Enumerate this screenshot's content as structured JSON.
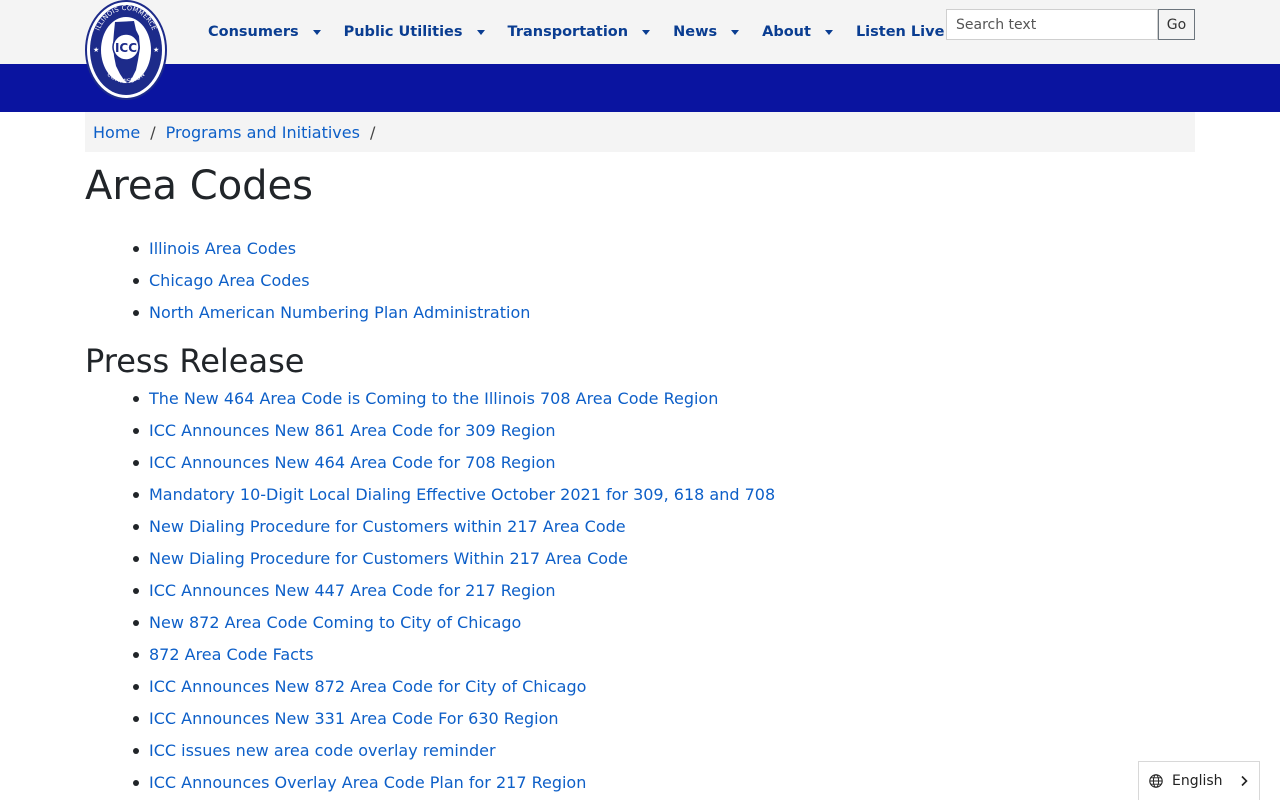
{
  "header": {
    "logo": {
      "alt_text": "ICC",
      "ring_text_top": "ILLINOIS COMMERCE",
      "ring_text_bottom": "COMMISSION"
    },
    "nav": [
      {
        "label": "Consumers",
        "has_dropdown": true
      },
      {
        "label": "Public Utilities",
        "has_dropdown": true
      },
      {
        "label": "Transportation",
        "has_dropdown": true
      },
      {
        "label": "News",
        "has_dropdown": true
      },
      {
        "label": "About",
        "has_dropdown": true
      },
      {
        "label": "Listen Live",
        "has_dropdown": false
      }
    ],
    "search": {
      "placeholder": "Search text",
      "value": "",
      "button_label": "Go"
    }
  },
  "breadcrumb": {
    "items": [
      "Home",
      "Programs and Initiatives"
    ],
    "separator": "/"
  },
  "main": {
    "title": "Area Codes",
    "area_links": [
      "Illinois Area Codes",
      "Chicago Area Codes",
      "North American Numbering Plan Administration"
    ],
    "press_heading": "Press Release",
    "press_links": [
      "The New 464 Area Code is Coming to the Illinois 708 Area Code Region",
      "ICC Announces New 861 Area Code for 309 Region",
      "ICC Announces New 464 Area Code for 708 Region",
      "Mandatory 10-Digit Local Dialing Effective October 2021 for 309, 618 and 708",
      "New Dialing Procedure for Customers within 217 Area Code",
      "New Dialing Procedure for Customers Within 217 Area Code",
      "ICC Announces New 447 Area Code for 217 Region",
      "New 872 Area Code Coming to City of Chicago",
      "872 Area Code Facts",
      "ICC Announces New 872 Area Code for City of Chicago",
      "ICC Announces New 331 Area Code For 630 Region",
      "ICC issues new area code overlay reminder",
      "ICC Announces Overlay Area Code Plan for 217 Region"
    ]
  },
  "language_selector": {
    "label": "English",
    "icon": "globe-icon"
  },
  "colors": {
    "nav_text": "#0a3d91",
    "blue_band": "#0a14a0",
    "link": "#0d5fc8",
    "topbar_bg": "#f4f4f4"
  }
}
